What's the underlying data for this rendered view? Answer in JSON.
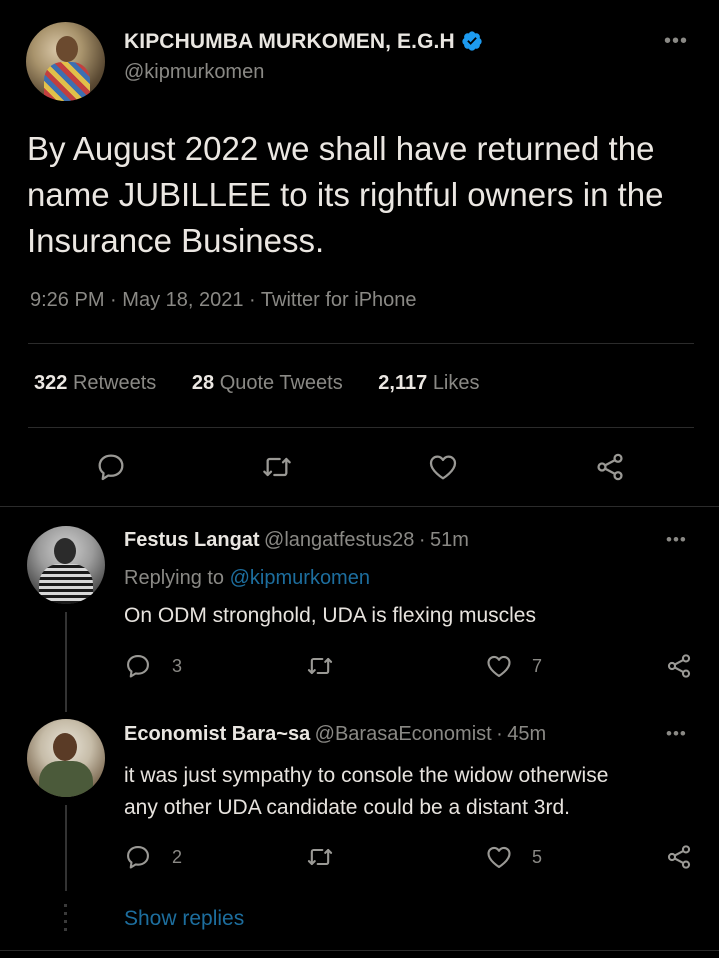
{
  "main_tweet": {
    "author_name": "KIPCHUMBA MURKOMEN, E.G.H",
    "handle": "@kipmurkomen",
    "text": "By August 2022 we shall have returned the name JUBILLEE to its rightful owners in the Insurance Business.",
    "time": "9:26 PM",
    "date": "May 18, 2021",
    "source": "Twitter for iPhone",
    "retweets_count": "322",
    "retweets_label": "Retweets",
    "quotes_count": "28",
    "quotes_label": "Quote Tweets",
    "likes_count": "2,117",
    "likes_label": "Likes",
    "more_label": "•••"
  },
  "replies": [
    {
      "author_name": "Festus Langat",
      "handle": "@langatfestus28",
      "age": "51m",
      "replying_prefix": "Replying to",
      "replying_to": "@kipmurkomen",
      "text": "On ODM stronghold, UDA is flexing muscles",
      "reply_count": "3",
      "like_count": "7",
      "more_label": "•••"
    },
    {
      "author_name": "Economist Bara~sa",
      "handle": "@BarasaEconomist",
      "age": "45m",
      "text_line1": "it was just sympathy to console the widow otherwise",
      "text_line2": "any other UDA candidate could be a distant 3rd.",
      "reply_count": "2",
      "like_count": "5",
      "more_label": "•••"
    }
  ],
  "show_replies_label": "Show replies",
  "separator": "·",
  "colors": {
    "background": "#000000",
    "text": "#e7e3de",
    "muted": "#8a8985",
    "link": "#1d6e9e",
    "verified": "#1d9bf0"
  },
  "icons": [
    "verified-icon",
    "reply-icon",
    "retweet-icon",
    "like-icon",
    "share-icon",
    "more-icon"
  ]
}
